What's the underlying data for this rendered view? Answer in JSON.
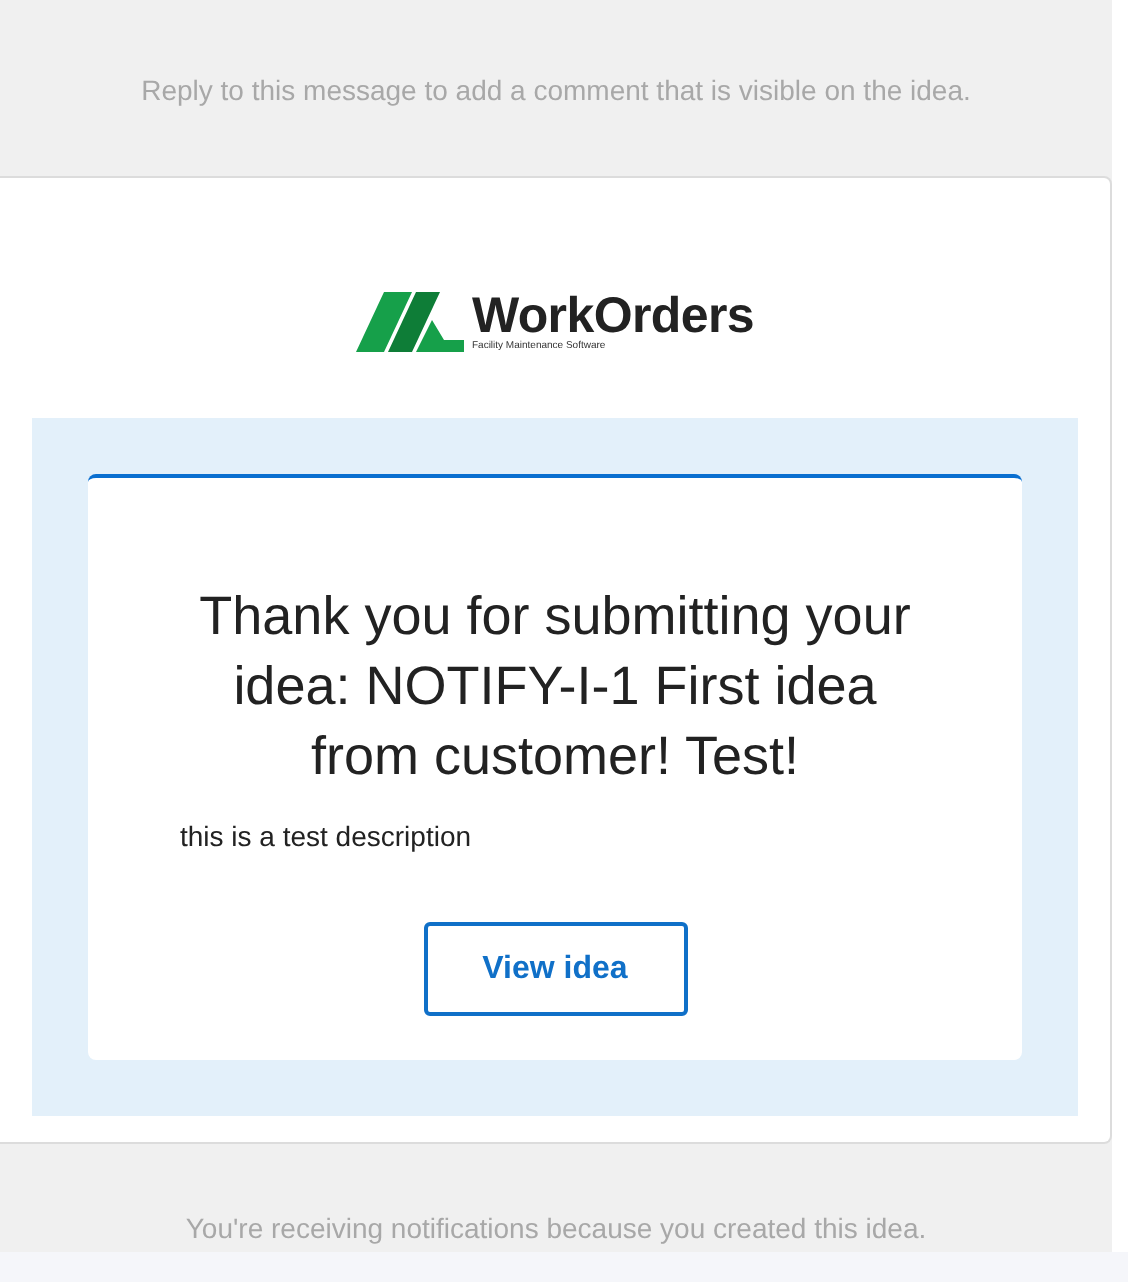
{
  "header_note": "Reply to this message to add a comment that is visible on the idea.",
  "logo": {
    "name": "WorkOrders",
    "tagline": "Facility Maintenance Software"
  },
  "message": {
    "title": "Thank you for submitting your idea: NOTIFY-I-1 First idea from customer! Test!",
    "description": "this is a test description",
    "button": "View idea"
  },
  "footer_note": "You're receiving notifications because you created this idea."
}
